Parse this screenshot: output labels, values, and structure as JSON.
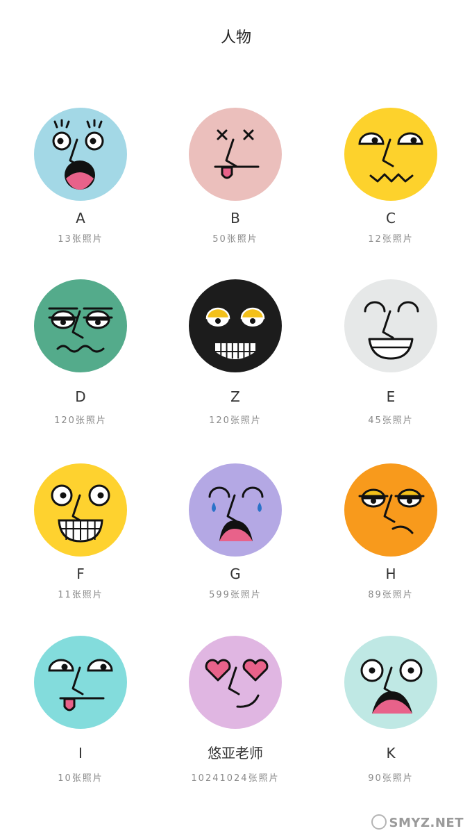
{
  "header": {
    "title": "人物"
  },
  "people": [
    {
      "name": "A",
      "count": "13张照片",
      "color": "#a3d8e6",
      "face": "shocked-face-icon"
    },
    {
      "name": "B",
      "count": "50张照片",
      "color": "#ebbfbc",
      "face": "dizzy-tongue-face-icon"
    },
    {
      "name": "C",
      "count": "12张照片",
      "color": "#fdd22c",
      "face": "zigzag-mouth-face-icon"
    },
    {
      "name": "D",
      "count": "120张照片",
      "color": "#54ab8b",
      "face": "queasy-face-icon"
    },
    {
      "name": "Z",
      "count": "120张照片",
      "color": "#1c1c1c",
      "face": "grinning-dark-face-icon"
    },
    {
      "name": "E",
      "count": "45张照片",
      "color": "#e6e8e8",
      "face": "happy-smile-face-icon"
    },
    {
      "name": "F",
      "count": "11张照片",
      "color": "#fed22f",
      "face": "grinning-teeth-face-icon"
    },
    {
      "name": "G",
      "count": "599张照片",
      "color": "#b4a8e4",
      "face": "crying-face-icon"
    },
    {
      "name": "H",
      "count": "89张照片",
      "color": "#f89a1c",
      "face": "unimpressed-face-icon"
    },
    {
      "name": "I",
      "count": "10张照片",
      "color": "#83dcdc",
      "face": "tongue-out-face-icon"
    },
    {
      "name": "悠亚老师",
      "count": "10241024张照片",
      "color": "#e0b6e2",
      "face": "heart-eyes-face-icon"
    },
    {
      "name": "K",
      "count": "90张照片",
      "color": "#bfe8e4",
      "face": "scared-face-icon"
    }
  ],
  "watermark": {
    "text": "SMYZ.NET"
  }
}
